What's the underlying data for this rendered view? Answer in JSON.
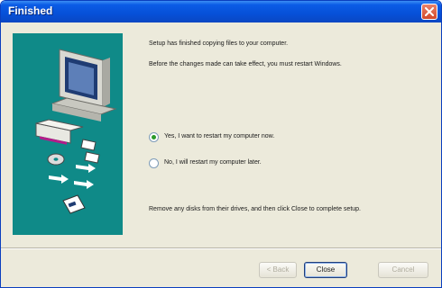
{
  "window": {
    "title": "Finished"
  },
  "content": {
    "line1": "Setup has finished copying files to your computer.",
    "line2": "Before the changes made can take effect, you must restart Windows.",
    "options": [
      {
        "label": "Yes, I want to restart my computer now.",
        "checked": true
      },
      {
        "label": "No, I will restart my computer later.",
        "checked": false
      }
    ],
    "instruction": "Remove any disks from their drives, and then click Close to complete setup."
  },
  "buttons": {
    "back": "< Back",
    "close": "Close",
    "cancel": "Cancel"
  },
  "colors": {
    "panel": "#0f8a88",
    "titlebar": "#0650d8",
    "dialog_bg": "#eceadb"
  },
  "icons": {
    "panel": "computer-with-disks-illustration",
    "close": "close-x-icon"
  }
}
